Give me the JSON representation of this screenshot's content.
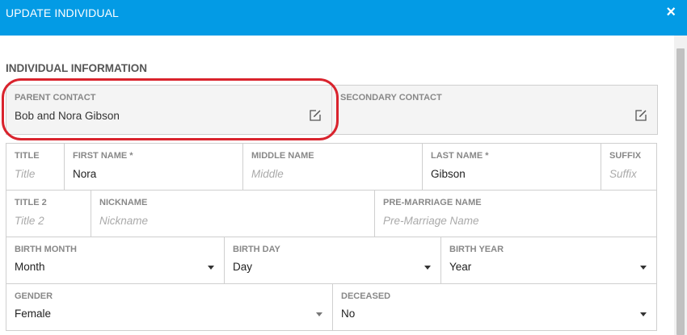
{
  "header": {
    "title": "UPDATE INDIVIDUAL",
    "close_icon": "×"
  },
  "section": {
    "title": "INDIVIDUAL INFORMATION"
  },
  "parent_contact": {
    "label": "PARENT CONTACT",
    "value": "Bob and Nora Gibson"
  },
  "secondary_contact": {
    "label": "SECONDARY CONTACT",
    "value": ""
  },
  "fields": {
    "title": {
      "label": "TITLE",
      "value": "",
      "placeholder": "Title"
    },
    "first_name": {
      "label": "FIRST NAME *",
      "value": "Nora",
      "placeholder": ""
    },
    "middle_name": {
      "label": "MIDDLE NAME",
      "value": "",
      "placeholder": "Middle"
    },
    "last_name": {
      "label": "LAST NAME *",
      "value": "Gibson",
      "placeholder": ""
    },
    "suffix": {
      "label": "SUFFIX",
      "value": "",
      "placeholder": "Suffix"
    },
    "title2": {
      "label": "TITLE 2",
      "value": "",
      "placeholder": "Title 2"
    },
    "nickname": {
      "label": "NICKNAME",
      "value": "",
      "placeholder": "Nickname"
    },
    "pre_marriage_name": {
      "label": "PRE-MARRIAGE NAME",
      "value": "",
      "placeholder": "Pre-Marriage Name"
    },
    "birth_month": {
      "label": "BIRTH MONTH",
      "value": "Month"
    },
    "birth_day": {
      "label": "BIRTH DAY",
      "value": "Day"
    },
    "birth_year": {
      "label": "BIRTH YEAR",
      "value": "Year"
    },
    "gender": {
      "label": "GENDER",
      "value": "Female"
    },
    "deceased": {
      "label": "DECEASED",
      "value": "No"
    }
  },
  "colors": {
    "header": "#039be5",
    "highlight": "#d9232d"
  },
  "icons": {
    "close": "close-icon",
    "edit": "edit-icon",
    "dropdown": "chevron-down-icon"
  }
}
